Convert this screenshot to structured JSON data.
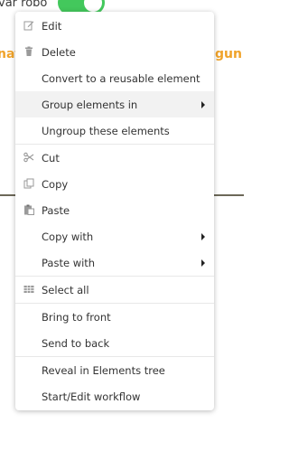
{
  "background": {
    "top_label": "var robo",
    "orange_left": "nat",
    "orange_right": "gun",
    "toggle_on": true,
    "accent_green": "#43c85c",
    "accent_orange": "#f0a32a"
  },
  "menu": {
    "items": [
      {
        "label": "Edit",
        "icon": "edit-icon"
      },
      {
        "label": "Delete",
        "icon": "trash-icon"
      },
      {
        "label": "Convert to a reusable element"
      },
      {
        "label": "Group elements in",
        "submenu": true
      },
      {
        "label": "Ungroup these elements"
      },
      {
        "label": "Cut",
        "icon": "scissors-icon"
      },
      {
        "label": "Copy",
        "icon": "copy-icon"
      },
      {
        "label": "Paste",
        "icon": "paste-icon"
      },
      {
        "label": "Copy with",
        "submenu": true
      },
      {
        "label": "Paste with",
        "submenu": true
      },
      {
        "label": "Select all",
        "icon": "grid-icon"
      },
      {
        "label": "Bring to front"
      },
      {
        "label": "Send to back"
      },
      {
        "label": "Reveal in Elements tree"
      },
      {
        "label": "Start/Edit workflow"
      }
    ]
  }
}
